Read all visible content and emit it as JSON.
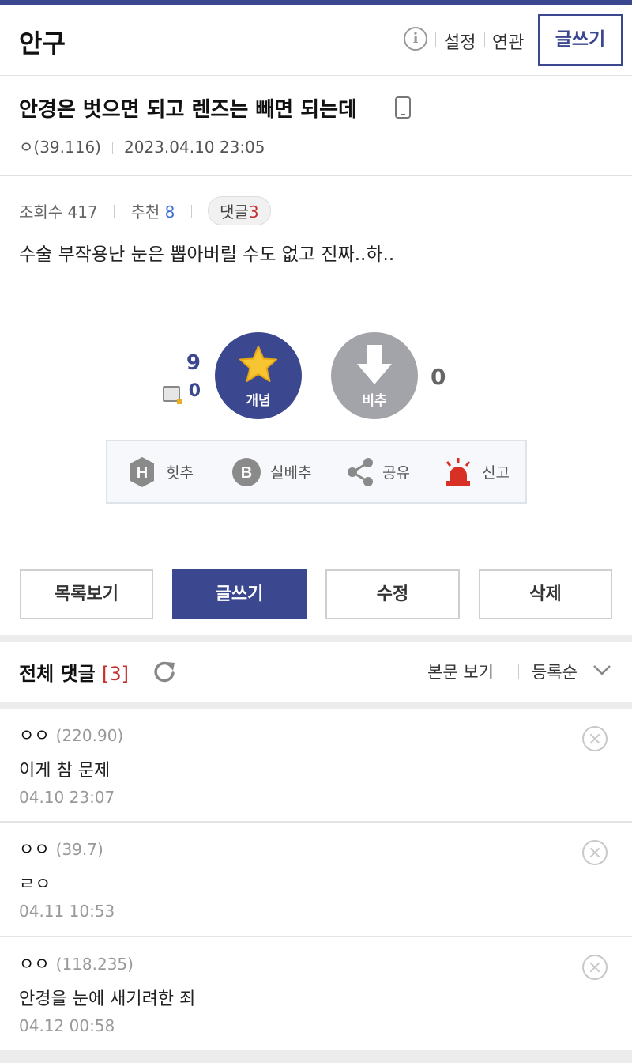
{
  "header": {
    "gallery_name": "안구",
    "info_icon": "info-icon",
    "settings_label": "설정",
    "related_label": "연관",
    "write_label": "글쓰기"
  },
  "post": {
    "title": "안경은 벗으면 되고 렌즈는 빼면 되는데",
    "device_icon": "mobile-phone-icon",
    "author": "ㅇ(39.116)",
    "date": "2023.04.10 23:05",
    "views_label": "조회수 417",
    "recommend_label": "추천",
    "recommend_value": "8",
    "comments_label": "댓글",
    "comments_value": "3",
    "body": "수술 부작용난 눈은 뽑아버릴 수도 없고 진짜..하.."
  },
  "vote": {
    "up_count": "9",
    "fixed_up_count": "0",
    "up_label": "개념",
    "down_label": "비추",
    "down_count": "0",
    "up_color": "#3b4890",
    "down_color": "#a3a3aa"
  },
  "actions": {
    "hit_label": "힛추",
    "best_label": "실베추",
    "share_label": "공유",
    "report_label": "신고"
  },
  "nav": {
    "list_label": "목록보기",
    "write_label": "글쓰기",
    "edit_label": "수정",
    "delete_label": "삭제"
  },
  "comments_header": {
    "title": "전체 댓글",
    "count": "[3]",
    "view_body_label": "본문 보기",
    "order_label": "등록순"
  },
  "comments": [
    {
      "author": "ㅇㅇ",
      "ip": "(220.90)",
      "text": "이게 참 문제",
      "date": "04.10 23:07"
    },
    {
      "author": "ㅇㅇ",
      "ip": "(39.7)",
      "text": "ㄹㅇ",
      "date": "04.11 10:53"
    },
    {
      "author": "ㅇㅇ",
      "ip": "(118.235)",
      "text": "안경을 눈에 새기려한 죄",
      "date": "04.12 00:58"
    }
  ]
}
